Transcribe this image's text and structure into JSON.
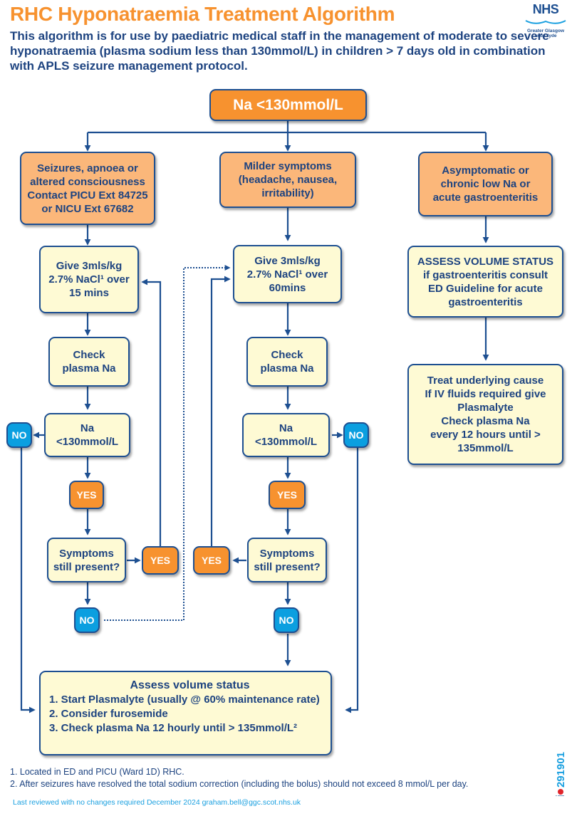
{
  "header": {
    "title": "RHC Hyponatraemia Treatment Algorithm",
    "intro": "This algorithm is for use by paediatric medical staff in the management of moderate to severe hyponatraemia (plasma sodium less than 130mmol/L) in children > 7 days old in combination with APLS seizure management protocol.",
    "logo": {
      "name": "NHS",
      "line1": "Greater Glasgow",
      "line2": "and Clyde"
    }
  },
  "colors": {
    "title_orange": "#f7922f",
    "box_orange": "#f7922f",
    "box_light_orange": "#fbb77a",
    "box_cream": "#fefad4",
    "box_blue": "#0b9fe0",
    "line_navy": "#1d4f91",
    "text_navy": "#1d4380",
    "review_blue": "#1aa0e0",
    "ref_dot_red": "#e0242b"
  },
  "flow": {
    "start": "Na <130mmol/L",
    "severe": "Seizures, apnoea or\naltered consciousness\nContact PICU Ext 84725\nor NICU Ext 67682",
    "milder": "Milder symptoms\n(headache, nausea,\nirritability)",
    "asymptomatic": "Asymptomatic or\nchronic low Na or\nacute gastroenteritis",
    "left": {
      "give": "Give 3mls/kg\n2.7% NaCl¹ over\n15 mins",
      "check": "Check\nplasma Na",
      "na": "Na\n<130mmol/L",
      "no1": "NO",
      "yes1": "YES",
      "symptoms": "Symptoms\nstill present?",
      "yes2": "YES",
      "no2": "NO"
    },
    "middle": {
      "give": "Give 3mls/kg\n2.7% NaCl¹ over\n60mins",
      "check": "Check\nplasma Na",
      "na": "Na\n<130mmol/L",
      "no1": "NO",
      "yes1": "YES",
      "symptoms": "Symptoms\nstill present?",
      "yes2": "YES",
      "no2": "NO"
    },
    "right": {
      "assess": "ASSESS VOLUME STATUS\nif gastroenteritis consult\nED Guideline for acute\ngastroenteritis",
      "treat": "Treat underlying cause\nIf IV fluids required give\nPlasmalyte\nCheck plasma Na\nevery 12 hours until >\n135mmol/L"
    },
    "final": {
      "heading": "Assess volume status",
      "items": [
        "1.  Start Plasmalyte (usually @ 60% maintenance rate)",
        "2.  Consider furosemide",
        "3.  Check plasma Na 12 hourly until > 135mmol/L²"
      ]
    }
  },
  "footnotes": [
    "1.  Located in ED and PICU (Ward 1D) RHC.",
    "2.  After seizures have resolved the total sodium correction (including the bolus) should not exceed 8 mmol/L per day."
  ],
  "review": "Last reviewed with no changes required December 2024 graham.bell@ggc.scot.nhs.uk",
  "reference": {
    "prefix": "mi",
    "number": "291901"
  }
}
